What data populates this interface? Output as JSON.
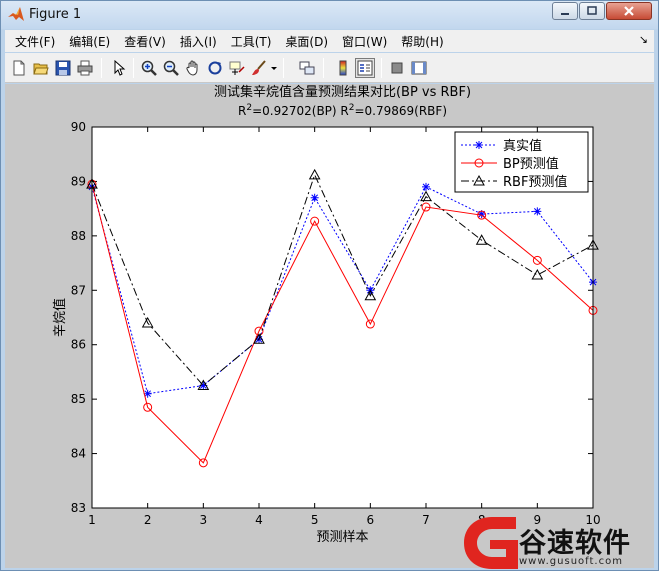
{
  "window": {
    "title": "Figure 1",
    "controls": {
      "minimize": "─",
      "maximize": "□",
      "close": "✕"
    }
  },
  "menu": [
    "文件(F)",
    "编辑(E)",
    "查看(V)",
    "插入(I)",
    "工具(T)",
    "桌面(D)",
    "窗口(W)",
    "帮助(H)"
  ],
  "menu_overflow_glyph": "↘",
  "toolbar": [
    "new-figure-icon",
    "open-file-icon",
    "save-icon",
    "print-icon",
    "pointer-icon",
    "zoom-in-icon",
    "zoom-out-icon",
    "pan-hand-icon",
    "rotate-3d-icon",
    "data-cursor-icon",
    "brush-icon",
    "brush-dropdown-icon",
    "link-plot-icon",
    "colorbar-icon",
    "legend-icon",
    "hide-plot-tools-icon",
    "show-plot-tools-icon"
  ],
  "chart_data": {
    "type": "line",
    "title": "测试集辛烷值含量预测结果对比(BP vs RBF)",
    "subtitle": {
      "bp": {
        "r": "R",
        "sup": "2",
        "text": "=0.92702(BP)"
      },
      "rbf": {
        "r": "R",
        "sup": "2",
        "text": "=0.79869(RBF)"
      }
    },
    "xlabel": "预测样本",
    "ylabel": "辛烷值",
    "xlim": [
      1,
      10
    ],
    "ylim": [
      83,
      90
    ],
    "xticks": [
      "1",
      "2",
      "3",
      "4",
      "5",
      "6",
      "7",
      "8",
      "9",
      "10"
    ],
    "yticks": [
      "83",
      "84",
      "85",
      "86",
      "87",
      "88",
      "89",
      "90"
    ],
    "grid": false,
    "legend_position": "top-right",
    "x": [
      1,
      2,
      3,
      4,
      5,
      6,
      7,
      8,
      9,
      10
    ],
    "series": [
      {
        "name": "真实值",
        "color": "#0000ff",
        "marker": "star",
        "dash": "dotted",
        "values": [
          88.9,
          85.1,
          85.25,
          86.1,
          88.7,
          87.0,
          88.9,
          88.4,
          88.45,
          87.15
        ]
      },
      {
        "name": "BP预测值",
        "color": "#ff0000",
        "marker": "circle",
        "dash": "solid",
        "values": [
          88.95,
          84.85,
          83.83,
          86.25,
          88.27,
          86.38,
          88.53,
          88.38,
          87.55,
          86.63
        ]
      },
      {
        "name": "RBF预测值",
        "color": "#000000",
        "marker": "triangle",
        "dash": "dashdot",
        "values": [
          88.95,
          86.4,
          85.25,
          86.1,
          89.12,
          86.9,
          88.72,
          87.92,
          87.28,
          87.83
        ]
      }
    ]
  },
  "watermark": {
    "brand": "谷速软件",
    "url": "www.gusuoft.com",
    "brand_color": "#e0251f"
  }
}
